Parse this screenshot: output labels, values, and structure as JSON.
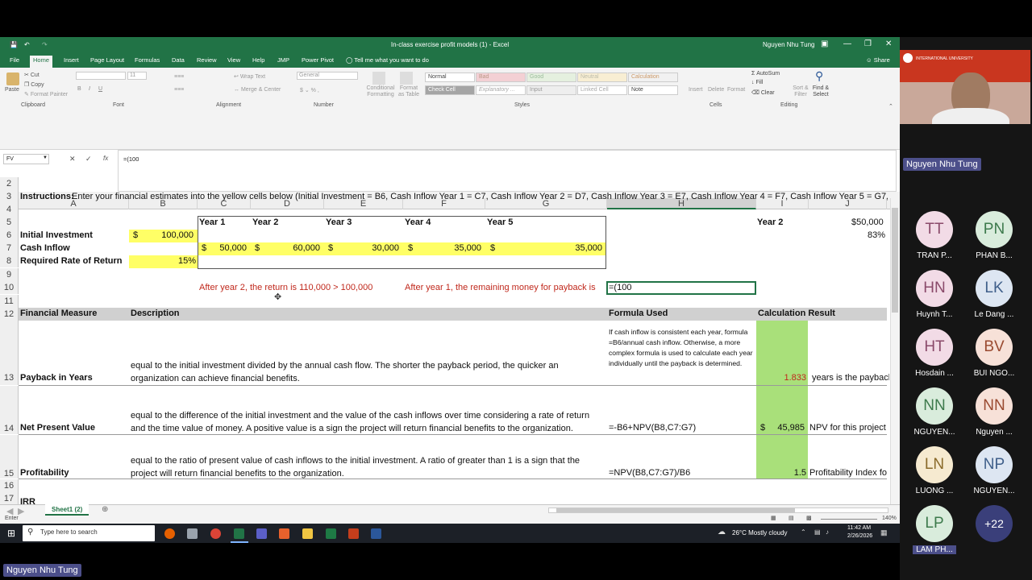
{
  "window": {
    "title": "In-class exercise profit models (1)  -  Excel",
    "user": "Nguyen Nhu Tung"
  },
  "menu": {
    "tabs": [
      "File",
      "Home",
      "Insert",
      "Page Layout",
      "Formulas",
      "Data",
      "Review",
      "View",
      "Help",
      "JMP",
      "Power Pivot"
    ],
    "tell_me": "Tell me what you want to do",
    "share": "Share"
  },
  "ribbon": {
    "paste": "Paste",
    "cut": "Cut",
    "copy": "Copy",
    "format_painter": "Format Painter",
    "clipboard": "Clipboard",
    "font_size": "11",
    "font": "Font",
    "wrap_text": "Wrap Text",
    "merge_center": "Merge & Center",
    "alignment": "Alignment",
    "number_format": "General",
    "number": "Number",
    "conditional_formatting": "Conditional Formatting",
    "format_as_table": "Format as Table",
    "styles": [
      "Normal",
      "Bad",
      "Good",
      "Neutral",
      "Calculation",
      "Check Cell",
      "Explanatory ...",
      "Input",
      "Linked Cell",
      "Note"
    ],
    "styles_label": "Styles",
    "insert": "Insert",
    "delete": "Delete",
    "format": "Format",
    "cells": "Cells",
    "autosum": "AutoSum",
    "fill": "Fill",
    "clear": "Clear",
    "sort_filter": "Sort & Filter",
    "find_select": "Find & Select",
    "editing": "Editing"
  },
  "formula_bar": {
    "name_box": "FV",
    "fx": "fx",
    "content": "=(100"
  },
  "columns": [
    "A",
    "B",
    "C",
    "D",
    "E",
    "F",
    "G",
    "H",
    "I",
    "J"
  ],
  "rows": [
    "2",
    "3",
    "4",
    "5",
    "6",
    "7",
    "8",
    "9",
    "10",
    "11",
    "12",
    "13",
    "14",
    "15",
    "16",
    "17"
  ],
  "sheet": {
    "instructions_label": "Instructions:",
    "instructions_text": " Enter your financial estimates into the yellow cells below (Initial Investment = B6, Cash Inflow Year 1 = C7, Cash Inflow Year 2 = D7, Cash Inflow Year 3 = E7, Cash Inflow Year 4 = F7, Cash Inflow Year 5 = G7,",
    "years": [
      "Year 1",
      "Year 2",
      "Year 3",
      "Year 4",
      "Year 5"
    ],
    "initial_investment_label": "Initial Investment",
    "initial_investment_cur": "$",
    "initial_investment": "100,000",
    "cash_inflow_label": "Cash Inflow",
    "cash_inflows": [
      "50,000",
      "60,000",
      "30,000",
      "35,000",
      "35,000"
    ],
    "currency": "$",
    "rate_label": "Required Rate of Return",
    "rate": "15%",
    "i5": "Year 2",
    "j5": "$50,000",
    "j6": "83%",
    "note_c10": "After year 2, the return is 110,000 > 100,000",
    "note_f10": "After year 1, the remaining money for payback is",
    "h10": "=(100",
    "headers": {
      "measure": "Financial Measure",
      "description": "Description",
      "formula": "Formula Used",
      "result": "Calculation Result"
    },
    "payback": {
      "label": "Payback in Years",
      "desc": "equal to the initial investment divided by the annual cash flow. The shorter the payback period, the quicker an organization can achieve financial benefits.",
      "formula": "If cash inflow is consistent each year, formula =B6/annual cash inflow. Otherwise, a more complex formula is used to calculate each year individually until the payback is determined.",
      "result": "1.833",
      "comment": "years is the paybacl"
    },
    "npv": {
      "label": "Net Present Value",
      "desc": "equal to the difference of the initial investment and the value of the cash inflows over time considering a rate of return and the time value of money. A positive value is a sign the project will return financial benefits to the organization.",
      "formula": "=-B6+NPV(B8,C7:G7)",
      "result_cur": "$",
      "result": "45,985",
      "comment": "NPV for this project"
    },
    "profit": {
      "label": "Profitability",
      "desc": "equal to the ratio of present value of cash inflows to the initial investment.  A ratio of greater than 1 is a sign that the project will return financial benefits to the organization.",
      "formula": "=NPV(B8,C7:G7)/B6",
      "result": "1.5",
      "comment": "Profitability Index fo"
    },
    "row17": "IRR"
  },
  "sheet_tab": "Sheet1 (2)",
  "status": {
    "mode": "Enter",
    "zoom": "140%"
  },
  "taskbar": {
    "search": "Type here to search",
    "weather": "26°C  Mostly cloudy",
    "time": "11:42 AM",
    "date": "2/26/2026"
  },
  "meeting": {
    "presenter": "Nguyen Nhu Tung",
    "university": "INTERNATIONAL UNIVERSITY",
    "participants": [
      {
        "initials": "TT",
        "name": "TRAN P...",
        "color": "#f2dbe6",
        "text": "#8a4a6a"
      },
      {
        "initials": "PN",
        "name": "PHAN B...",
        "color": "#d9ecdc",
        "text": "#3d7a4c"
      },
      {
        "initials": "HN",
        "name": "Huynh T...",
        "color": "#f2dbe6",
        "text": "#8a4a6a"
      },
      {
        "initials": "LK",
        "name": "Le Dang ...",
        "color": "#dde6f2",
        "text": "#3f5f8a"
      },
      {
        "initials": "HT",
        "name": "Hosdain ...",
        "color": "#f2dbe6",
        "text": "#8a4a6a"
      },
      {
        "initials": "BV",
        "name": "BUI NGO...",
        "color": "#f7e1d8",
        "text": "#9a4a30"
      },
      {
        "initials": "NN",
        "name": "NGUYEN...",
        "color": "#d9ecdc",
        "text": "#3d7a4c"
      },
      {
        "initials": "NN",
        "name": "Nguyen ...",
        "color": "#f7e1d8",
        "text": "#9a4a30"
      },
      {
        "initials": "LN",
        "name": "LUONG ...",
        "color": "#f6ead0",
        "text": "#8a6a2a"
      },
      {
        "initials": "NP",
        "name": "NGUYEN...",
        "color": "#dde6f2",
        "text": "#3f5f8a"
      },
      {
        "initials": "LP",
        "name": "LAM PH...",
        "color": "#d9ecdc",
        "text": "#3d7a4c"
      }
    ],
    "more": "+22"
  }
}
